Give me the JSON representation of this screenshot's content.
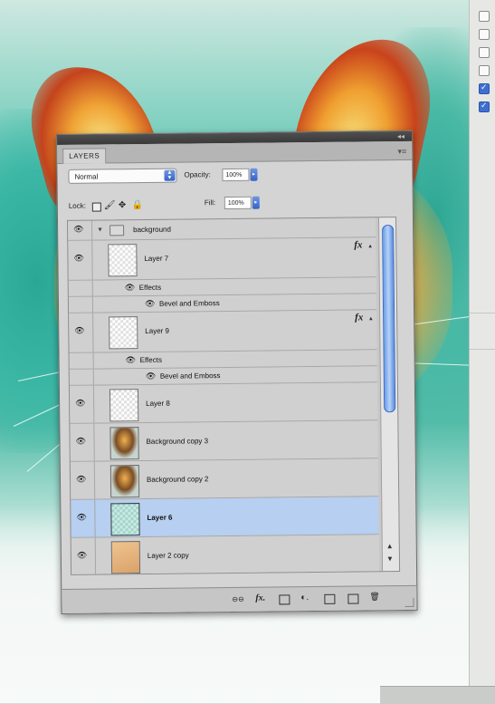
{
  "panel": {
    "tab_label": "LAYERS",
    "blend_mode": "Normal",
    "opacity_label": "Opacity:",
    "opacity_value": "100%",
    "lock_label": "Lock:",
    "fill_label": "Fill:",
    "fill_value": "100%",
    "titlebar_glyph": "◂◂",
    "menu_glyph": "▾≡"
  },
  "layers": [
    {
      "type": "group",
      "name": "background"
    },
    {
      "type": "layer",
      "name": "Layer 7",
      "fx": "fx",
      "thumb": "transparent"
    },
    {
      "type": "effects",
      "name": "Effects"
    },
    {
      "type": "effect",
      "name": "Bevel and Emboss"
    },
    {
      "type": "layer",
      "name": "Layer 9",
      "fx": "fx",
      "thumb": "transparent"
    },
    {
      "type": "effects",
      "name": "Effects"
    },
    {
      "type": "effect",
      "name": "Bevel and Emboss"
    },
    {
      "type": "layer",
      "name": "Layer 8",
      "thumb": "transparent"
    },
    {
      "type": "layer",
      "name": "Background copy 3",
      "thumb": "photo"
    },
    {
      "type": "layer",
      "name": "Background copy 2",
      "thumb": "photo"
    },
    {
      "type": "layer",
      "name": "Layer 6",
      "thumb": "teal",
      "selected": true
    },
    {
      "type": "layer",
      "name": "Layer 2 copy",
      "thumb": "tan"
    }
  ],
  "footer": {
    "link_glyph": "⊖⊖",
    "fx_label": "fx.",
    "adjust_glyph": "◐.",
    "delete_glyph": "🗑"
  },
  "icons": {
    "eye": "👁",
    "brush": "🖌",
    "move": "✥",
    "lock": "🔒",
    "twirl": "▼"
  },
  "colors": {
    "selected_row": "#b7cff0",
    "scroll_thumb": "#6a9de8",
    "panel_bg": "#d4d4d4"
  }
}
